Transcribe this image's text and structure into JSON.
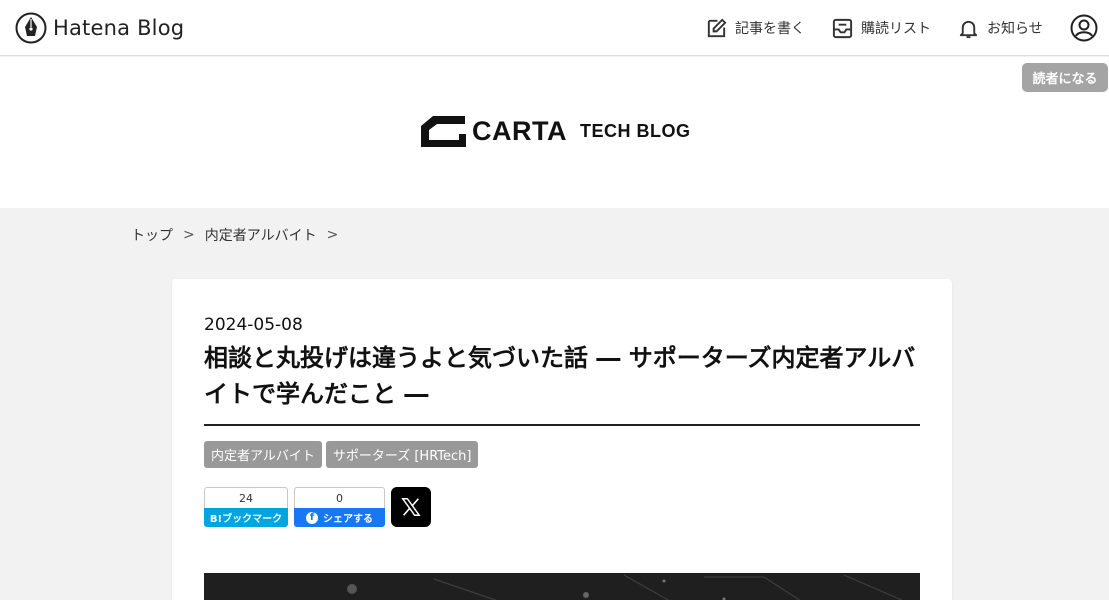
{
  "topbar": {
    "logo_text": "Hatena Blog",
    "nav": {
      "write": "記事を書く",
      "subscriptions": "購読リスト",
      "notifications": "お知らせ"
    }
  },
  "header": {
    "subscribe_label": "読者になる",
    "brand_name": "CARTA",
    "brand_sub": "TECH BLOG"
  },
  "breadcrumb": {
    "items": [
      "トップ",
      "内定者アルバイト"
    ],
    "separator": ">"
  },
  "article": {
    "date": "2024-05-08",
    "title": "相談と丸投げは違うよと気づいた話 ― サポーターズ内定者アルバイトで学んだこと ―",
    "tags": [
      "内定者アルバイト",
      "サポーターズ [HRTech]"
    ],
    "share": {
      "hatena_count": "24",
      "hatena_label": "B!ブックマーク",
      "facebook_count": "0",
      "facebook_label": "シェアする",
      "facebook_icon": "f"
    }
  },
  "colors": {
    "tag_bg": "#999999",
    "hatena_blue": "#00a4de",
    "facebook_blue": "#1877f2",
    "subscribe_bg": "#a4a4a4"
  }
}
